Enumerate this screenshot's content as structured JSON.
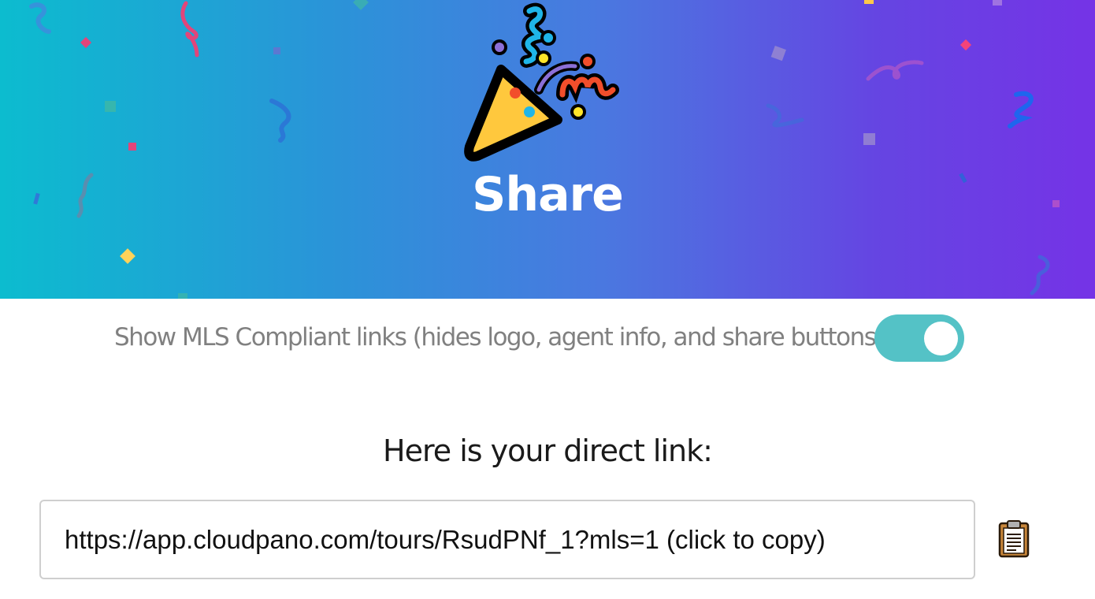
{
  "header": {
    "title": "Share",
    "icon": "party-popper-icon",
    "gradient": [
      "#0cbccf",
      "#7533e6"
    ]
  },
  "mls_option": {
    "label": "Show MLS Compliant links (hides logo, agent info, and share buttons)",
    "enabled": true,
    "toggle_color": "#54c2c6"
  },
  "direct_link": {
    "heading": "Here is your direct link:",
    "link_text": "https://app.cloudpano.com/tours/RsudPNf_1?mls=1 (click to copy)",
    "copy_icon": "clipboard-icon"
  }
}
